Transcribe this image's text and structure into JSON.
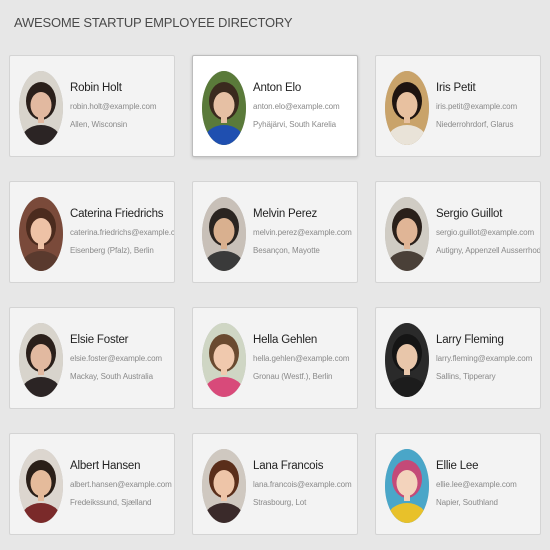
{
  "page": {
    "title": "AWESOME STARTUP EMPLOYEE DIRECTORY"
  },
  "employees": [
    {
      "name": "Robin Holt",
      "email": "robin.holt@example.com",
      "location": "Allen, Wisconsin",
      "avatar": {
        "bg": "#d8d4cc",
        "hair": "#2a1f1a",
        "skin": "#e2b9a0",
        "shirt": "#2b2424"
      }
    },
    {
      "name": "Anton Elo",
      "email": "anton.elo@example.com",
      "location": "Pyhäjärvi, South Karelia",
      "avatar": {
        "bg": "#5a7a3a",
        "hair": "#3a2a1e",
        "skin": "#e6c0a4",
        "shirt": "#1f4fb0"
      }
    },
    {
      "name": "Iris Petit",
      "email": "iris.petit@example.com",
      "location": "Niederrohrdorf, Glarus",
      "avatar": {
        "bg": "#c9a36a",
        "hair": "#1e1410",
        "skin": "#e8c1a0",
        "shirt": "#e9e3d8"
      }
    },
    {
      "name": "Caterina Friedrichs",
      "email": "caterina.friedrichs@example.com",
      "location": "Eisenberg (Pfalz), Berlin",
      "avatar": {
        "bg": "#7a4a3a",
        "hair": "#4b2b1e",
        "skin": "#eec2a6",
        "shirt": "#5a3a2e"
      }
    },
    {
      "name": "Melvin Perez",
      "email": "melvin.perez@example.com",
      "location": "Besançon, Mayotte",
      "avatar": {
        "bg": "#c8c0b8",
        "hair": "#2a2420",
        "skin": "#d9b08f",
        "shirt": "#3a3a3a"
      }
    },
    {
      "name": "Sergio Guillot",
      "email": "sergio.guillot@example.com",
      "location": "Autigny, Appenzell Ausserrhoden",
      "avatar": {
        "bg": "#d0ccc4",
        "hair": "#2a201a",
        "skin": "#e0b596",
        "shirt": "#4a4038"
      }
    },
    {
      "name": "Elsie Foster",
      "email": "elsie.foster@example.com",
      "location": "Mackay, South Australia",
      "avatar": {
        "bg": "#d8d4cc",
        "hair": "#2a1f1a",
        "skin": "#e2b9a0",
        "shirt": "#2b2424"
      }
    },
    {
      "name": "Hella Gehlen",
      "email": "hella.gehlen@example.com",
      "location": "Gronau (Westf.), Berlin",
      "avatar": {
        "bg": "#cfd6c4",
        "hair": "#6a4a30",
        "skin": "#f0c9ae",
        "shirt": "#d84a7a"
      }
    },
    {
      "name": "Larry Fleming",
      "email": "larry.fleming@example.com",
      "location": "Sallins, Tipperary",
      "avatar": {
        "bg": "#2a2a2a",
        "hair": "#151515",
        "skin": "#e8c6aa",
        "shirt": "#1c1c1c"
      }
    },
    {
      "name": "Albert Hansen",
      "email": "albert.hansen@example.com",
      "location": "Fredeikssund, Sjælland",
      "avatar": {
        "bg": "#dcd6cf",
        "hair": "#2a1f18",
        "skin": "#e5bb9b",
        "shirt": "#7a2a2a"
      }
    },
    {
      "name": "Lana Francois",
      "email": "lana.francois@example.com",
      "location": "Strasbourg, Lot",
      "avatar": {
        "bg": "#cfc8c0",
        "hair": "#5a2e1a",
        "skin": "#eec5a8",
        "shirt": "#3a2a2a"
      }
    },
    {
      "name": "Ellie Lee",
      "email": "ellie.lee@example.com",
      "location": "Napier, Southland",
      "avatar": {
        "bg": "#4aa6c8",
        "hair": "#c44a78",
        "skin": "#f3d3bc",
        "shirt": "#e8c12a"
      }
    }
  ],
  "selected_index": 1
}
